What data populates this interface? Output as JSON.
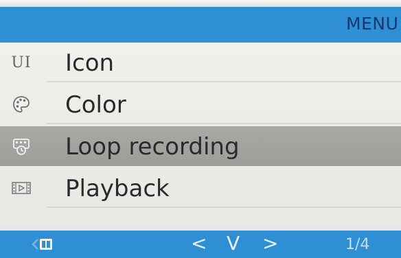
{
  "header": {
    "title": "MENU"
  },
  "menu": {
    "items": [
      {
        "label": "Icon",
        "icon": "ui-icon",
        "icon_text": "UI",
        "selected": false
      },
      {
        "label": "Color",
        "icon": "palette-icon",
        "selected": false
      },
      {
        "label": "Loop recording",
        "icon": "loop-recording-icon",
        "selected": true
      },
      {
        "label": "Playback",
        "icon": "playback-icon",
        "selected": false
      }
    ]
  },
  "footer": {
    "back_icon": "back-icon",
    "prev_symbol": "<",
    "down_symbol": "V",
    "next_symbol": ">",
    "page_indicator": "1/4"
  },
  "colors": {
    "header_bar": "#2f8fd4",
    "footer_bar": "#2f8fd4",
    "selected_row": "#a3a29f",
    "list_background": "#eeede9"
  }
}
